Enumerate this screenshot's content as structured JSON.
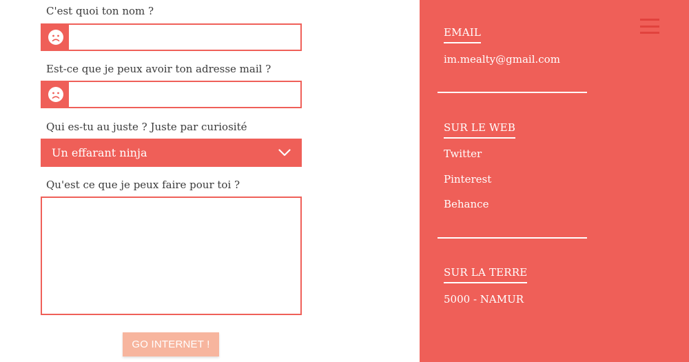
{
  "form": {
    "name_label": "C'est quoi ton nom ?",
    "name_value": "",
    "email_label": "Est-ce que je peux avoir ton adresse mail ?",
    "email_value": "",
    "role_label": "Qui es-tu au juste ? Juste par curiosité",
    "role_selected": "Un effarant ninja",
    "message_label": "Qu'est ce que je peux faire pour toi ?",
    "message_value": "",
    "submit_label": "GO INTERNET !",
    "field_icon": "sad-face-icon"
  },
  "contact": {
    "email_title": "EMAIL",
    "email_address": "im.mealty@gmail.com",
    "web_title": "SUR LE WEB",
    "web_links": [
      "Twitter",
      "Pinterest",
      "Behance"
    ],
    "earth_title": "SUR LA TERRE",
    "location": "5000 - NAMUR"
  },
  "menu_icon": "hamburger-menu-icon",
  "colors": {
    "accent": "#ef5f58",
    "submit_button": "#f7b59e",
    "text": "#3a3a3a",
    "menu_icon": "#e1423d"
  }
}
